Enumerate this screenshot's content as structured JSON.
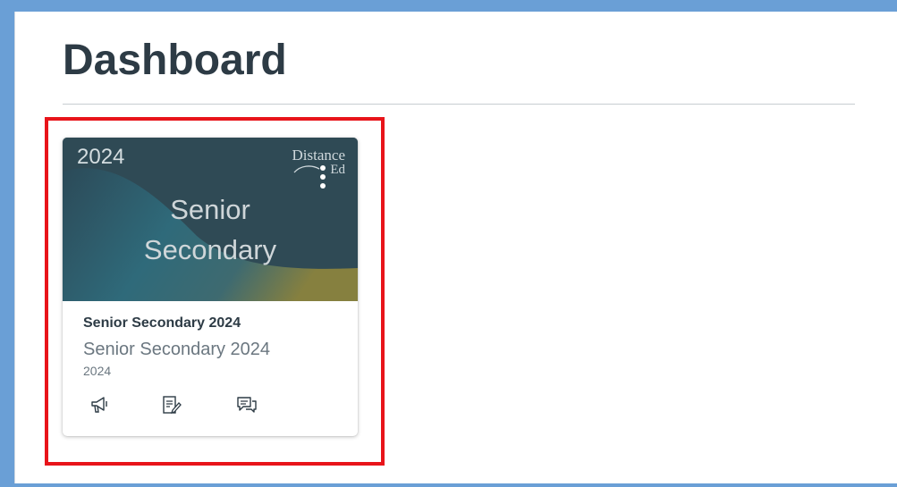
{
  "page": {
    "title": "Dashboard"
  },
  "course_card": {
    "hero": {
      "year": "2024",
      "title_line1": "Senior",
      "title_line2": "Secondary",
      "logo_line1": "Distance",
      "logo_line2": "Ed",
      "hero_color": "#2f4a55"
    },
    "name": "Senior Secondary 2024",
    "subtitle": "Senior Secondary 2024",
    "term": "2024",
    "actions": [
      {
        "icon": "announcements-icon"
      },
      {
        "icon": "assignments-icon"
      },
      {
        "icon": "discussions-icon"
      }
    ]
  },
  "colors": {
    "frame": "#6a9fd6",
    "highlight": "#e8141a",
    "heading": "#2d3b45"
  }
}
